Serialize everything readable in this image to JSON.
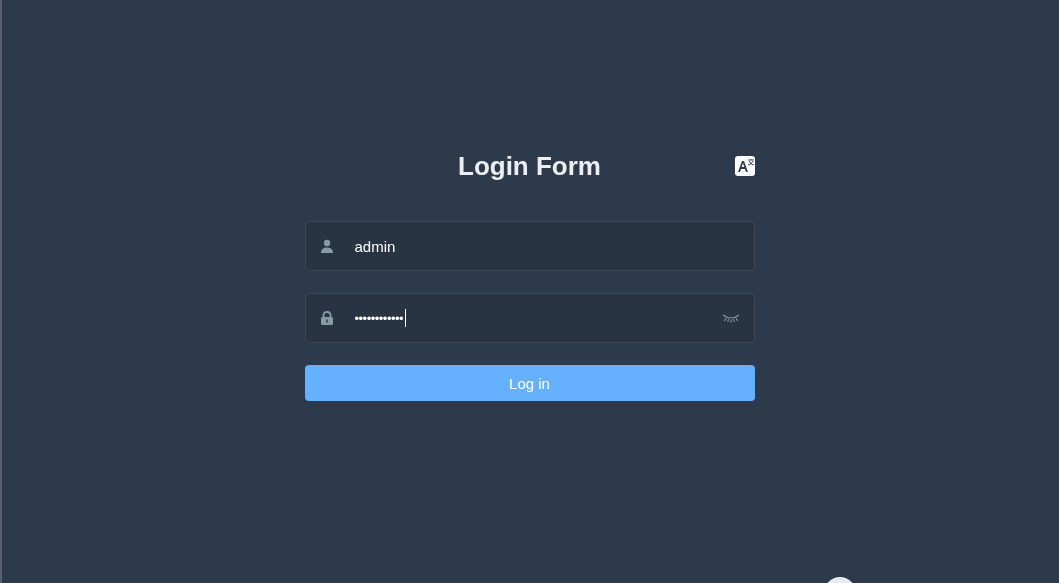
{
  "title": "Login Form",
  "username": {
    "value": "admin"
  },
  "password": {
    "value": "••••••••••••",
    "focused": true
  },
  "login_button": {
    "label": "Log in"
  }
}
